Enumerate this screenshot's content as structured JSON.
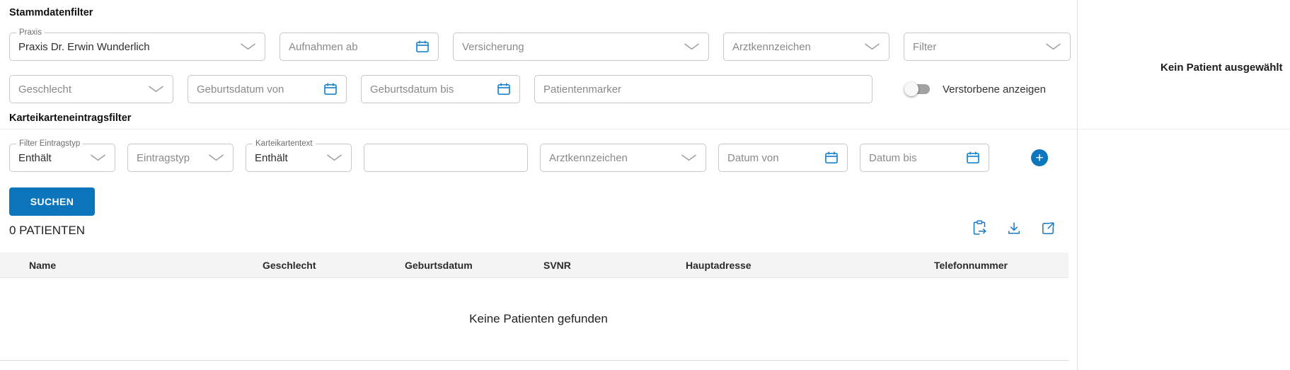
{
  "headings": {
    "stammdaten": "Stammdatenfilter",
    "karteikarten": "Karteikarteneintragsfilter"
  },
  "row1": {
    "praxis": {
      "label": "Praxis",
      "value": "Praxis Dr. Erwin Wunderlich"
    },
    "aufnahmen_ab": {
      "placeholder": "Aufnahmen ab"
    },
    "versicherung": {
      "placeholder": "Versicherung"
    },
    "arztkennzeichen": {
      "placeholder": "Arztkennzeichen"
    },
    "filter": {
      "placeholder": "Filter"
    }
  },
  "row2": {
    "geschlecht": {
      "placeholder": "Geschlecht"
    },
    "geburtsdatum_von": {
      "placeholder": "Geburtsdatum von"
    },
    "geburtsdatum_bis": {
      "placeholder": "Geburtsdatum bis"
    },
    "patientenmarker": {
      "placeholder": "Patientenmarker",
      "value": ""
    },
    "verstorbene_toggle": {
      "label": "Verstorbene anzeigen",
      "state": "off"
    }
  },
  "row3": {
    "filter_eintragstyp": {
      "label": "Filter Eintragstyp",
      "value": "Enthält"
    },
    "eintragstyp": {
      "placeholder": "Eintragstyp"
    },
    "karteikartentext": {
      "label": "Karteikartentext",
      "value": "Enthält"
    },
    "freitext": {
      "placeholder": "",
      "value": ""
    },
    "arztkennzeichen": {
      "placeholder": "Arztkennzeichen"
    },
    "datum_von": {
      "placeholder": "Datum von"
    },
    "datum_bis": {
      "placeholder": "Datum bis"
    },
    "add_button": "+"
  },
  "actions": {
    "suchen": "SUCHEN"
  },
  "results": {
    "count_label": "0 PATIENTEN",
    "toolbar_icons": [
      "copy-to-clipboard-icon",
      "download-icon",
      "open-external-icon"
    ],
    "table_columns": [
      "Name",
      "Geschlecht",
      "Geburtsdatum",
      "SVNR",
      "Hauptadresse",
      "Telefonnummer"
    ],
    "empty_message": "Keine Patienten gefunden"
  },
  "side_panel": {
    "empty_message": "Kein Patient ausgewählt"
  },
  "colors": {
    "accent_blue": "#0c74ba",
    "icon_blue": "#1878c2",
    "field_border": "#c8c8c8",
    "table_header_bg": "#f4f4f4"
  }
}
